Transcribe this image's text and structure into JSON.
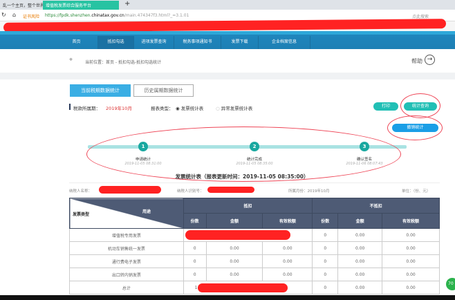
{
  "browser": {
    "tabs": [
      {
        "label": "乱一个主页，整个世界"
      },
      {
        "label": "增值税发票综合服务平台"
      }
    ],
    "security_label": "证书风险",
    "url_prefix": "https://fpdk.shenzhen.",
    "url_domain": "chinatax.gov.cn",
    "url_path": "/main.474347f3.html?_=3.1.01",
    "search_label": "点此搜索"
  },
  "nav": {
    "items": [
      "首页",
      "抵扣勾选",
      "进项发票查询",
      "税务事项通知书",
      "发票下载",
      "企业档案信息"
    ]
  },
  "breadcrumb": {
    "label": "当前位置：首页 - 抵扣勾选-抵扣勾选统计",
    "help": "帮助"
  },
  "tabs": {
    "current": "当前税期数据统计",
    "history": "历史属期数据统计"
  },
  "filters": {
    "period_label": "税款所属期：",
    "period_value": "2019年10月",
    "report_type_label": "报表类型：",
    "option1": "发票统计表",
    "option2": "异常发票统计表"
  },
  "actions": {
    "print": "打印",
    "query": "统计查询",
    "revoke": "撤销统计"
  },
  "steps": [
    {
      "num": "1",
      "label": "申请统计",
      "time": "2019-11-05 08:31:00"
    },
    {
      "num": "2",
      "label": "统计完成",
      "time": "2019-11-05 08:35:00"
    },
    {
      "num": "3",
      "label": "确认签名",
      "time": "2019-11-06 08:07:43"
    }
  ],
  "report": {
    "title": "发票统计表（报表更新时间：2019-11-05 08:35:00）",
    "taxpayer_name_label": "纳税人名称：",
    "taxpayer_id_label": "纳税人识别号：",
    "month": "所属月份：2019年10月",
    "unit": "单位：（份、元）"
  },
  "table": {
    "corner_type": "发票类型",
    "corner_use": "用途",
    "group1": "抵扣",
    "group2": "不抵扣",
    "cols": [
      "份数",
      "金额",
      "有效税额",
      "份数",
      "金额",
      "有效税额"
    ],
    "rows": [
      {
        "name": "增值税专用发票",
        "c4": "0",
        "c5": "0.00",
        "c6": "0.00"
      },
      {
        "name": "机动车销售统一发票",
        "c1": "0",
        "c2": "0.00",
        "c3": "0.00",
        "c4": "0",
        "c5": "0.00",
        "c6": "0.00"
      },
      {
        "name": "通行费电子发票",
        "c1": "0",
        "c2": "0.00",
        "c3": "0.00",
        "c4": "0",
        "c5": "0.00",
        "c6": "0.00"
      },
      {
        "name": "出口转内销发票",
        "c1": "0",
        "c2": "0.00",
        "c3": "0.00",
        "c4": "0",
        "c5": "0.00",
        "c6": "0.00"
      },
      {
        "name": "总计",
        "c1": "1",
        "c4": "0",
        "c5": "0.00",
        "c6": "0.00"
      }
    ]
  },
  "badge": "70"
}
